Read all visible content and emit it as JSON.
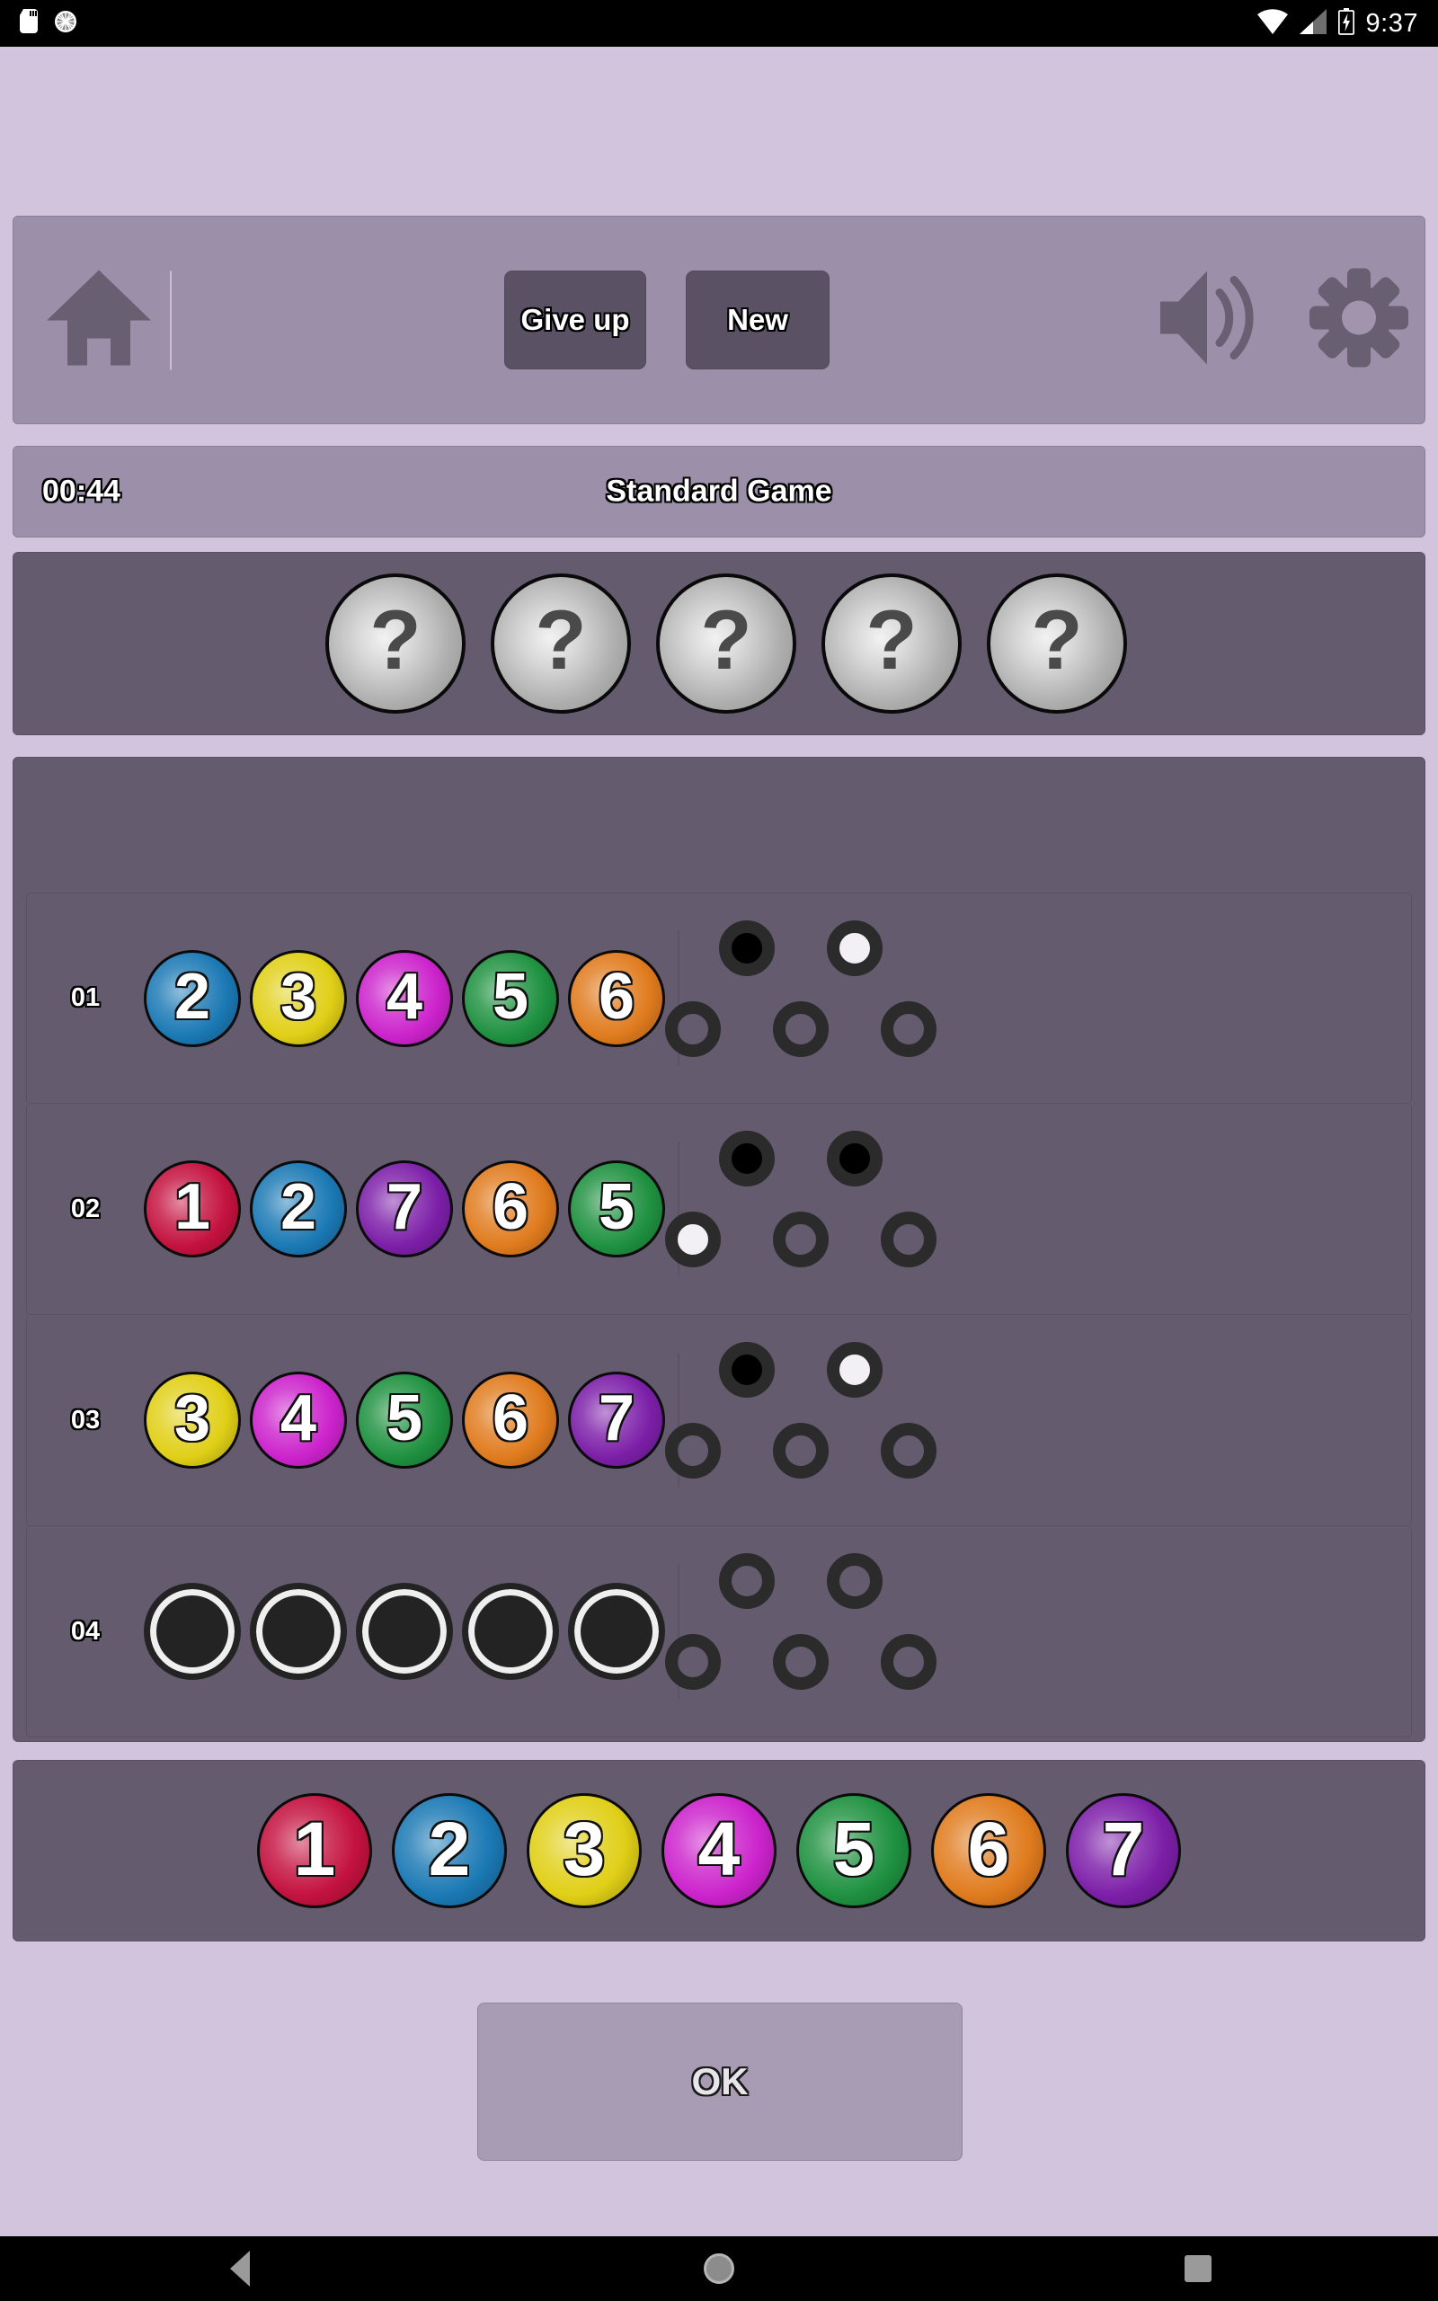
{
  "status_bar": {
    "time": "9:37",
    "icons_left": [
      "sd-card-icon",
      "sync-icon"
    ],
    "icons_right": [
      "wifi-icon",
      "cellular-signal-icon",
      "battery-charging-icon"
    ]
  },
  "toolbar": {
    "home_icon": "home-icon",
    "give_up_label": "Give up",
    "new_label": "New",
    "sound_icon": "sound-on-icon",
    "settings_icon": "gear-icon"
  },
  "statusline": {
    "timer": "00:44",
    "game_mode": "Standard Game"
  },
  "secret_row": {
    "pegs": [
      "?",
      "?",
      "?",
      "?",
      "?"
    ]
  },
  "colors": {
    "page_background": "#d3c4de",
    "panel_light": "#9c8fa9",
    "panel_dark": "#645b6e",
    "button_dark": "#5a5165",
    "ok_button": "#a89cb4",
    "peg_1": "#c4123f",
    "peg_2": "#1b79b4",
    "peg_3": "#e0cf17",
    "peg_4": "#cc23cc",
    "peg_5": "#1f9140",
    "peg_6": "#e07b1e",
    "peg_7": "#7c1fa8",
    "feedback_black": "#000000",
    "feedback_white": "#f2f0f4",
    "feedback_empty_ring": "#2b2b2b"
  },
  "palette": {
    "pegs": [
      {
        "value": "1",
        "color": "#c4123f"
      },
      {
        "value": "2",
        "color": "#1b79b4"
      },
      {
        "value": "3",
        "color": "#e0cf17"
      },
      {
        "value": "4",
        "color": "#cc23cc"
      },
      {
        "value": "5",
        "color": "#1f9140"
      },
      {
        "value": "6",
        "color": "#e07b1e"
      },
      {
        "value": "7",
        "color": "#7c1fa8"
      }
    ]
  },
  "guesses": [
    {
      "label": "01",
      "pegs": [
        {
          "value": "2",
          "color": "#1b79b4"
        },
        {
          "value": "3",
          "color": "#e0cf17"
        },
        {
          "value": "4",
          "color": "#cc23cc"
        },
        {
          "value": "5",
          "color": "#1f9140"
        },
        {
          "value": "6",
          "color": "#e07b1e"
        }
      ],
      "feedback": [
        "black",
        "white",
        "none",
        "none",
        "none"
      ],
      "black_count": 1,
      "white_count": 1
    },
    {
      "label": "02",
      "pegs": [
        {
          "value": "1",
          "color": "#c4123f"
        },
        {
          "value": "2",
          "color": "#1b79b4"
        },
        {
          "value": "7",
          "color": "#7c1fa8"
        },
        {
          "value": "6",
          "color": "#e07b1e"
        },
        {
          "value": "5",
          "color": "#1f9140"
        }
      ],
      "feedback": [
        "black",
        "black",
        "white",
        "none",
        "none"
      ],
      "black_count": 2,
      "white_count": 1
    },
    {
      "label": "03",
      "pegs": [
        {
          "value": "3",
          "color": "#e0cf17"
        },
        {
          "value": "4",
          "color": "#cc23cc"
        },
        {
          "value": "5",
          "color": "#1f9140"
        },
        {
          "value": "6",
          "color": "#e07b1e"
        },
        {
          "value": "7",
          "color": "#7c1fa8"
        }
      ],
      "feedback": [
        "black",
        "white",
        "none",
        "none",
        "none"
      ],
      "black_count": 1,
      "white_count": 1
    },
    {
      "label": "04",
      "pegs": [
        {
          "value": "",
          "color": ""
        },
        {
          "value": "",
          "color": ""
        },
        {
          "value": "",
          "color": ""
        },
        {
          "value": "",
          "color": ""
        },
        {
          "value": "",
          "color": ""
        }
      ],
      "feedback": [
        "none",
        "none",
        "none",
        "none",
        "none"
      ],
      "black_count": 0,
      "white_count": 0
    }
  ],
  "ok_button": {
    "label": "OK"
  },
  "nav_bar": {
    "back": "back-icon",
    "home": "home-circle-icon",
    "recents": "recents-icon"
  }
}
